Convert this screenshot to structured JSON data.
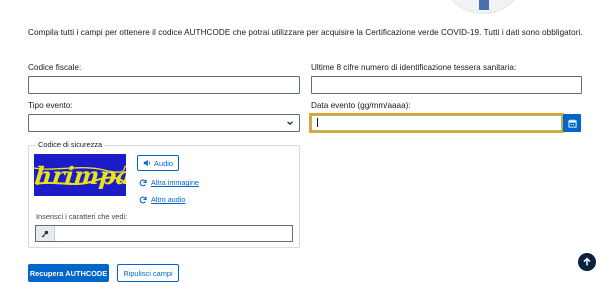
{
  "intro": "Compila tutti i campi per ottenere il codice AUTHCODE che potrai utilizzare per acquisire la Certificazione verde COVID-19. Tutti i dati sono obbligatori.",
  "form": {
    "codice_fiscale": {
      "label": "Codice fiscale:",
      "value": ""
    },
    "tessera": {
      "label": "Ultime 8 cifre numero di identificazione tessera sanitaria:",
      "value": ""
    },
    "tipo_evento": {
      "label": "Tipo evento:",
      "selected": ""
    },
    "data_evento": {
      "label": "Data evento (gg/mm/aaaa):",
      "value": ""
    }
  },
  "captcha": {
    "legend": "Codice di sicurezza",
    "image_text": "hrimpa",
    "audio_label": "Audio",
    "other_image_label": "Altra immagine",
    "other_audio_label": "Altro audio",
    "input_label": "Inserisci i caratteri che vedi:",
    "input_value": ""
  },
  "actions": {
    "submit_label": "Recupera AUTHCODE",
    "reset_label": "Ripulisci campi"
  },
  "colors": {
    "primary": "#0066cc",
    "captcha_bg": "#1b1bc8",
    "captcha_text": "#e8e21a",
    "focus_border": "#f0a020",
    "back_to_top": "#0a2240"
  },
  "icons": {
    "audio": "volume-icon",
    "refresh": "refresh-icon",
    "key": "key-icon",
    "calendar": "calendar-icon",
    "back_to_top": "arrow-up-icon",
    "chevron": "chevron-down-icon"
  }
}
